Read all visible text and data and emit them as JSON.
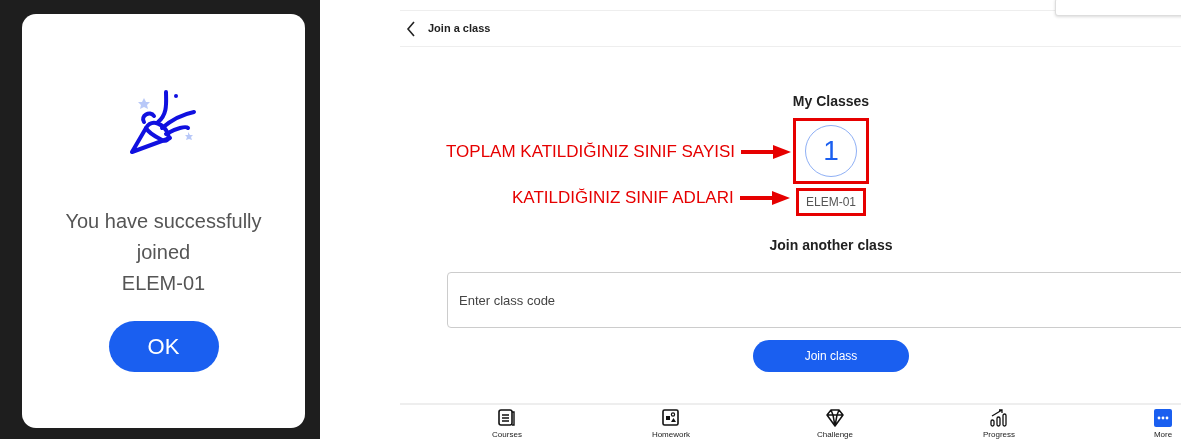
{
  "dialog": {
    "message_lines": [
      "You have successfully",
      "joined",
      "ELEM-01"
    ],
    "button": "OK"
  },
  "header": {
    "title": "Join a class"
  },
  "my_classes": {
    "title": "My Classes",
    "count": "1",
    "class_names": [
      "ELEM-01"
    ]
  },
  "join": {
    "title": "Join another class",
    "placeholder": "Enter class code",
    "button": "Join class"
  },
  "bottom_nav": [
    {
      "label": "Courses",
      "kind": "courses",
      "selected": false
    },
    {
      "label": "Homework",
      "kind": "homework",
      "selected": false
    },
    {
      "label": "Challenge",
      "kind": "challenge",
      "selected": false
    },
    {
      "label": "Progress",
      "kind": "progress",
      "selected": false
    },
    {
      "label": "More",
      "kind": "more",
      "selected": true
    }
  ],
  "annotations": [
    {
      "text": "TOPLAM KATILDIĞINIZ SINIF SAYISI"
    },
    {
      "text": "KATILDIĞINIZ SINIF ADLARI"
    }
  ]
}
